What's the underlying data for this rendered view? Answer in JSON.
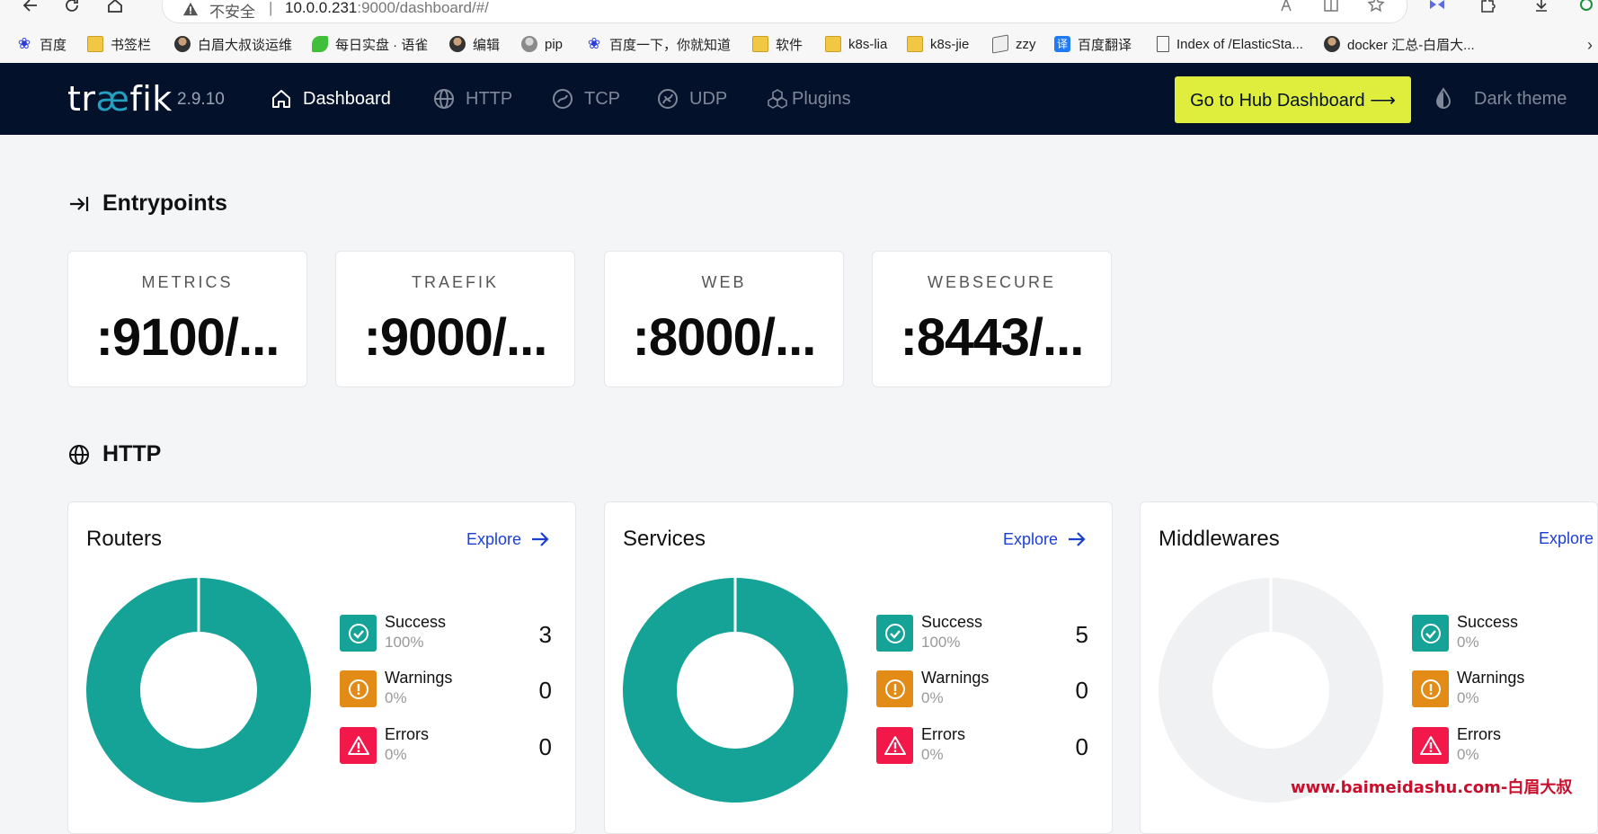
{
  "browser": {
    "address": {
      "insecure_label": "不安全",
      "separator": "|",
      "host": "10.0.0.231",
      "path": ":9000/dashboard/#/"
    },
    "bookmarks": [
      {
        "label": "百度",
        "icon": "paw-icon"
      },
      {
        "label": "书签栏",
        "icon": "folder-icon"
      },
      {
        "label": "白眉大叔谈运维",
        "icon": "person-icon"
      },
      {
        "label": "每日实盘 · 语雀",
        "icon": "leaf-icon"
      },
      {
        "label": "编辑",
        "icon": "person-icon"
      },
      {
        "label": "pip",
        "icon": "person-gray-icon"
      },
      {
        "label": "百度一下，你就知道",
        "icon": "paw-icon"
      },
      {
        "label": "软件",
        "icon": "folder-icon"
      },
      {
        "label": "k8s-lia",
        "icon": "folder-icon"
      },
      {
        "label": "k8s-jie",
        "icon": "folder-icon"
      },
      {
        "label": "zzy",
        "icon": "book-icon"
      },
      {
        "label": "百度翻译",
        "icon": "translate-icon",
        "glyph": "译"
      },
      {
        "label": "Index of /ElasticSta...",
        "icon": "page-icon"
      },
      {
        "label": "docker 汇总-白眉大...",
        "icon": "person-icon"
      }
    ]
  },
  "nav": {
    "logo_pre": "tr",
    "logo_ae": "æ",
    "logo_post": "fik",
    "version": "2.9.10",
    "items": [
      {
        "label": "Dashboard",
        "icon": "home-icon",
        "active": true
      },
      {
        "label": "HTTP",
        "icon": "globe-icon"
      },
      {
        "label": "TCP",
        "icon": "tcp-icon"
      },
      {
        "label": "UDP",
        "icon": "udp-icon"
      },
      {
        "label": "Plugins",
        "icon": "plugins-icon"
      }
    ],
    "hub_button": "Go to Hub Dashboard ⟶",
    "theme_label": "Dark theme"
  },
  "entrypoints": {
    "title": "Entrypoints",
    "items": [
      {
        "name": "METRICS",
        "address": ":9100/..."
      },
      {
        "name": "TRAEFIK",
        "address": ":9000/..."
      },
      {
        "name": "WEB",
        "address": ":8000/..."
      },
      {
        "name": "WEBSECURE",
        "address": ":8443/..."
      }
    ]
  },
  "http": {
    "title": "HTTP",
    "cards": [
      {
        "title": "Routers",
        "explore": "Explore",
        "stats": [
          {
            "label": "Success",
            "pct": "100%",
            "count": "3"
          },
          {
            "label": "Warnings",
            "pct": "0%",
            "count": "0"
          },
          {
            "label": "Errors",
            "pct": "0%",
            "count": "0"
          }
        ]
      },
      {
        "title": "Services",
        "explore": "Explore",
        "stats": [
          {
            "label": "Success",
            "pct": "100%",
            "count": "5"
          },
          {
            "label": "Warnings",
            "pct": "0%",
            "count": "0"
          },
          {
            "label": "Errors",
            "pct": "0%",
            "count": "0"
          }
        ]
      },
      {
        "title": "Middlewares",
        "explore": "Explore",
        "stats": [
          {
            "label": "Success",
            "pct": "0%"
          },
          {
            "label": "Warnings",
            "pct": "0%"
          },
          {
            "label": "Errors",
            "pct": "0%"
          }
        ]
      }
    ]
  },
  "colors": {
    "success": "#15a397",
    "warning": "#e28b17",
    "error": "#f2184a",
    "empty": "#f0f1f3",
    "nav_bg": "#03112b",
    "hub_button": "#dfee3c"
  },
  "watermark": "www.baimeidashu.com-白眉大叔"
}
